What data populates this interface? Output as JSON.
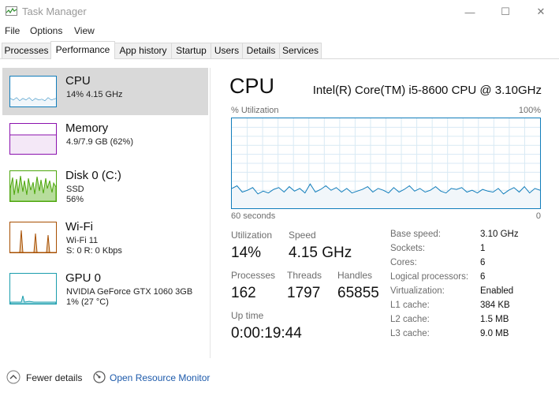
{
  "window": {
    "title": "Task Manager",
    "minimize": "—",
    "maximize": "☐",
    "close": "✕"
  },
  "menu": [
    "File",
    "Options",
    "View"
  ],
  "tabs": [
    "Processes",
    "Performance",
    "App history",
    "Startup",
    "Users",
    "Details",
    "Services"
  ],
  "active_tab": "Performance",
  "sidebar": [
    {
      "name": "CPU",
      "line1": "14% 4.15 GHz",
      "line2": ""
    },
    {
      "name": "Memory",
      "line1": "4.9/7.9 GB (62%)",
      "line2": ""
    },
    {
      "name": "Disk 0 (C:)",
      "line1": "SSD",
      "line2": "56%"
    },
    {
      "name": "Wi-Fi",
      "line1": "Wi-Fi 11",
      "line2": "S: 0 R: 0 Kbps"
    },
    {
      "name": "GPU 0",
      "line1": "NVIDIA GeForce GTX 1060 3GB",
      "line2": "1% (27 °C)"
    }
  ],
  "main": {
    "title": "CPU",
    "model": "Intel(R) Core(TM) i5-8600 CPU @ 3.10GHz",
    "graph": {
      "y_label": "% Utilization",
      "y_max_label": "100%",
      "x_left_label": "60 seconds",
      "x_right_label": "0",
      "utilization_percent": [
        22,
        25,
        18,
        20,
        23,
        16,
        19,
        17,
        21,
        23,
        18,
        24,
        19,
        22,
        17,
        27,
        18,
        21,
        25,
        20,
        23,
        18,
        22,
        17,
        19,
        21,
        24,
        18,
        22,
        20,
        17,
        23,
        18,
        21,
        25,
        19,
        22,
        18,
        20,
        24,
        19,
        17,
        22,
        21,
        23,
        18,
        20,
        17,
        21,
        19,
        18,
        22,
        16,
        20,
        23,
        18,
        24,
        17,
        22,
        20
      ]
    },
    "stats": {
      "utilization": {
        "label": "Utilization",
        "value": "14%"
      },
      "speed": {
        "label": "Speed",
        "value": "4.15 GHz"
      },
      "processes": {
        "label": "Processes",
        "value": "162"
      },
      "threads": {
        "label": "Threads",
        "value": "1797"
      },
      "handles": {
        "label": "Handles",
        "value": "65855"
      },
      "uptime": {
        "label": "Up time",
        "value": "0:00:19:44"
      }
    },
    "details": [
      {
        "label": "Base speed:",
        "value": "3.10 GHz"
      },
      {
        "label": "Sockets:",
        "value": "1"
      },
      {
        "label": "Cores:",
        "value": "6"
      },
      {
        "label": "Logical processors:",
        "value": "6"
      },
      {
        "label": "Virtualization:",
        "value": "Enabled"
      },
      {
        "label": "L1 cache:",
        "value": "384 KB"
      },
      {
        "label": "L2 cache:",
        "value": "1.5 MB"
      },
      {
        "label": "L3 cache:",
        "value": "9.0 MB"
      }
    ]
  },
  "footer": {
    "fewer_details": "Fewer details",
    "open_monitor": "Open Resource Monitor"
  },
  "colors": {
    "cpu": "#117dbb",
    "memory": "#8b12ae",
    "disk": "#4da60c",
    "wifi": "#a74f01",
    "gpu": "#1b9dad",
    "link": "#1d5aab",
    "selected": "#d9d9d9"
  }
}
